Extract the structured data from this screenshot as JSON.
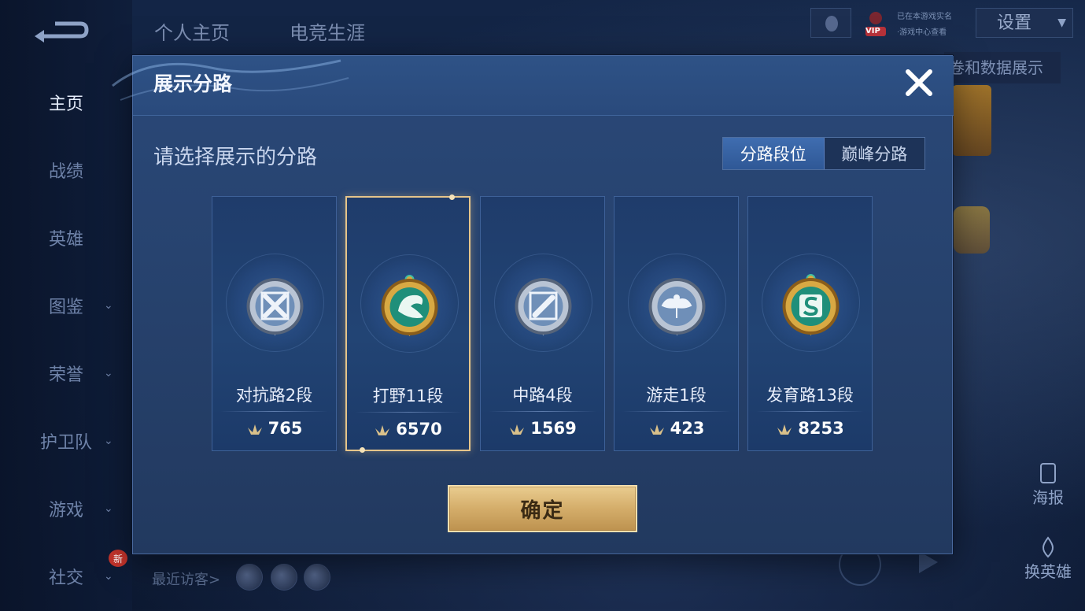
{
  "top_tabs": [
    "个人主页",
    "电竞生涯"
  ],
  "nav": {
    "items": [
      {
        "label": "主页",
        "chevron": false,
        "active": true
      },
      {
        "label": "战绩",
        "chevron": false,
        "active": false
      },
      {
        "label": "英雄",
        "chevron": false,
        "active": false
      },
      {
        "label": "图鉴",
        "chevron": true,
        "active": false
      },
      {
        "label": "荣誉",
        "chevron": true,
        "active": false
      },
      {
        "label": "护卫队",
        "chevron": true,
        "active": false
      },
      {
        "label": "游戏",
        "chevron": true,
        "active": false
      },
      {
        "label": "社交",
        "chevron": true,
        "active": false
      }
    ],
    "new_badge": "新"
  },
  "top_right": {
    "settings": "设置",
    "vip_badge": "VIP",
    "status_line1": "已在本游戏实名",
    "status_line2": "·游戏中心查看"
  },
  "right_banner": "卷和数据展示",
  "right_utils": {
    "poster": "海报",
    "change_hero": "换英雄"
  },
  "visitors_label": "最近访客>",
  "modal": {
    "title": "展示分路",
    "subtitle": "请选择展示的分路",
    "toggle": {
      "options": [
        "分路段位",
        "巅峰分路"
      ],
      "active_index": 0
    },
    "lanes": [
      {
        "name": "对抗路2段",
        "points": "765",
        "emblem": "silver-sword-emblem-icon",
        "selected": false
      },
      {
        "name": "打野11段",
        "points": "6570",
        "emblem": "gold-dragon-emblem-icon",
        "selected": true
      },
      {
        "name": "中路4段",
        "points": "1569",
        "emblem": "silver-staff-emblem-icon",
        "selected": false
      },
      {
        "name": "游走1段",
        "points": "423",
        "emblem": "silver-wings-emblem-icon",
        "selected": false
      },
      {
        "name": "发育路13段",
        "points": "8253",
        "emblem": "gold-s-emblem-icon",
        "selected": false
      }
    ],
    "confirm": "确定"
  },
  "colors": {
    "modal_bg": "#27436f",
    "selected_border": "#e6c58a",
    "confirm_gold": "#d4ad6a",
    "toggle_active": "#3f6db0"
  }
}
